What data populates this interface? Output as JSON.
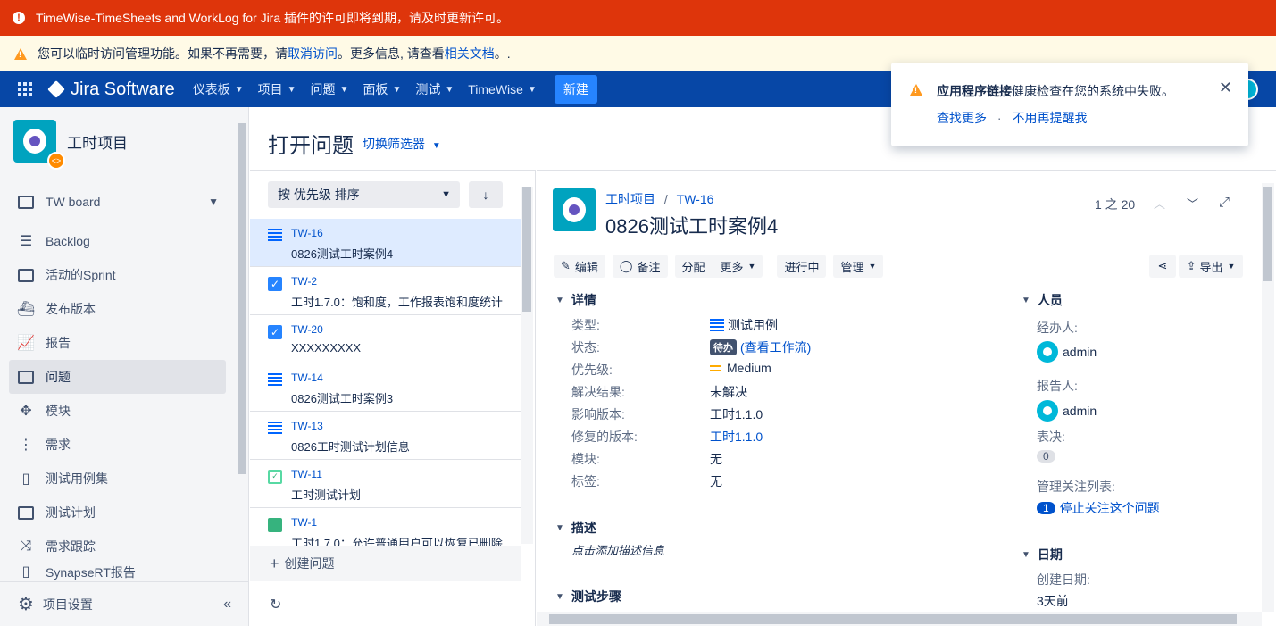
{
  "banners": {
    "error_text": "TimeWise-TimeSheets and WorkLog for Jira 插件的许可即将到期，请及时更新许可。",
    "warn_prefix": "您可以临时访问管理功能。如果不再需要，请 ",
    "warn_link1": "取消访问",
    "warn_mid": "。更多信息, 请查看 ",
    "warn_link2": "相关文档",
    "warn_suffix": "。."
  },
  "topnav": {
    "logo": "Jira Software",
    "items": [
      "仪表板",
      "项目",
      "问题",
      "面板",
      "测试",
      "TimeWise"
    ],
    "create": "新建"
  },
  "popup": {
    "msg_bold": "应用程序链接",
    "msg_rest": "健康检查在您的系统中失败。",
    "link1": "查找更多",
    "sep": "·",
    "link2": "不用再提醒我",
    "close": "✕"
  },
  "sidebar": {
    "project_name": "工时项目",
    "items": [
      {
        "label": "TW board"
      },
      {
        "label": "Backlog"
      },
      {
        "label": "活动的Sprint"
      },
      {
        "label": "发布版本"
      },
      {
        "label": "报告"
      },
      {
        "label": "问题"
      },
      {
        "label": "模块"
      },
      {
        "label": "需求"
      },
      {
        "label": "测试用例集"
      },
      {
        "label": "测试计划"
      },
      {
        "label": "需求跟踪"
      },
      {
        "label": "SynapseRT报告"
      }
    ],
    "settings": "项目设置"
  },
  "main": {
    "title": "打开问题",
    "filter_switch": "切换筛选器",
    "sort_label": "按 优先级 排序",
    "create_issue": "创建问题"
  },
  "issues": [
    {
      "key": "TW-16",
      "summary": "0826测试工时案例4",
      "type": "test-case"
    },
    {
      "key": "TW-2",
      "summary": "工时1.7.0：饱和度，工作报表饱和度统计",
      "type": "task"
    },
    {
      "key": "TW-20",
      "summary": "XXXXXXXXX",
      "type": "task"
    },
    {
      "key": "TW-14",
      "summary": "0826测试工时案例3",
      "type": "test-case"
    },
    {
      "key": "TW-13",
      "summary": "0826工时测试计划信息",
      "type": "test-case"
    },
    {
      "key": "TW-11",
      "summary": "工时测试计划",
      "type": "test-plan"
    },
    {
      "key": "TW-1",
      "summary": "工时1.7.0：允许普通用户可以恢复已删除",
      "type": "story"
    }
  ],
  "detail": {
    "breadcrumb_project": "工时项目",
    "breadcrumb_sep": "/",
    "breadcrumb_key": "TW-16",
    "title": "0826测试工时案例4",
    "pager": "1 之 20",
    "toolbar": {
      "edit": "编辑",
      "comment": "备注",
      "assign": "分配",
      "more": "更多",
      "in_progress": "进行中",
      "manage": "管理",
      "export": "导出"
    },
    "details_head": "详情",
    "fields": [
      {
        "label": "类型:",
        "value": "测试用例"
      },
      {
        "label": "状态:",
        "value": "待办",
        "extra": "(查看工作流)"
      },
      {
        "label": "优先级:",
        "value": "Medium"
      },
      {
        "label": "解决结果:",
        "value": "未解决"
      },
      {
        "label": "影响版本:",
        "value": "工时1.1.0"
      },
      {
        "label": "修复的版本:",
        "value": "工时1.1.0"
      },
      {
        "label": "模块:",
        "value": "无"
      },
      {
        "label": "标签:",
        "value": "无"
      }
    ],
    "description_head": "描述",
    "description_placeholder": "点击添加描述信息",
    "steps_head": "测试步骤",
    "people_head": "人员",
    "assignee_label": "经办人:",
    "assignee": "admin",
    "reporter_label": "报告人:",
    "reporter": "admin",
    "votes_label": "表决:",
    "votes": "0",
    "watchers_label": "管理关注列表:",
    "watchers": "1",
    "watch_link": "停止关注这个问题",
    "dates_head": "日期",
    "created_label": "创建日期:",
    "created": "3天前"
  },
  "colors": {
    "error": "#de350b",
    "warn_bg": "#fffae6",
    "nav": "#0747a6",
    "link": "#0052cc"
  }
}
